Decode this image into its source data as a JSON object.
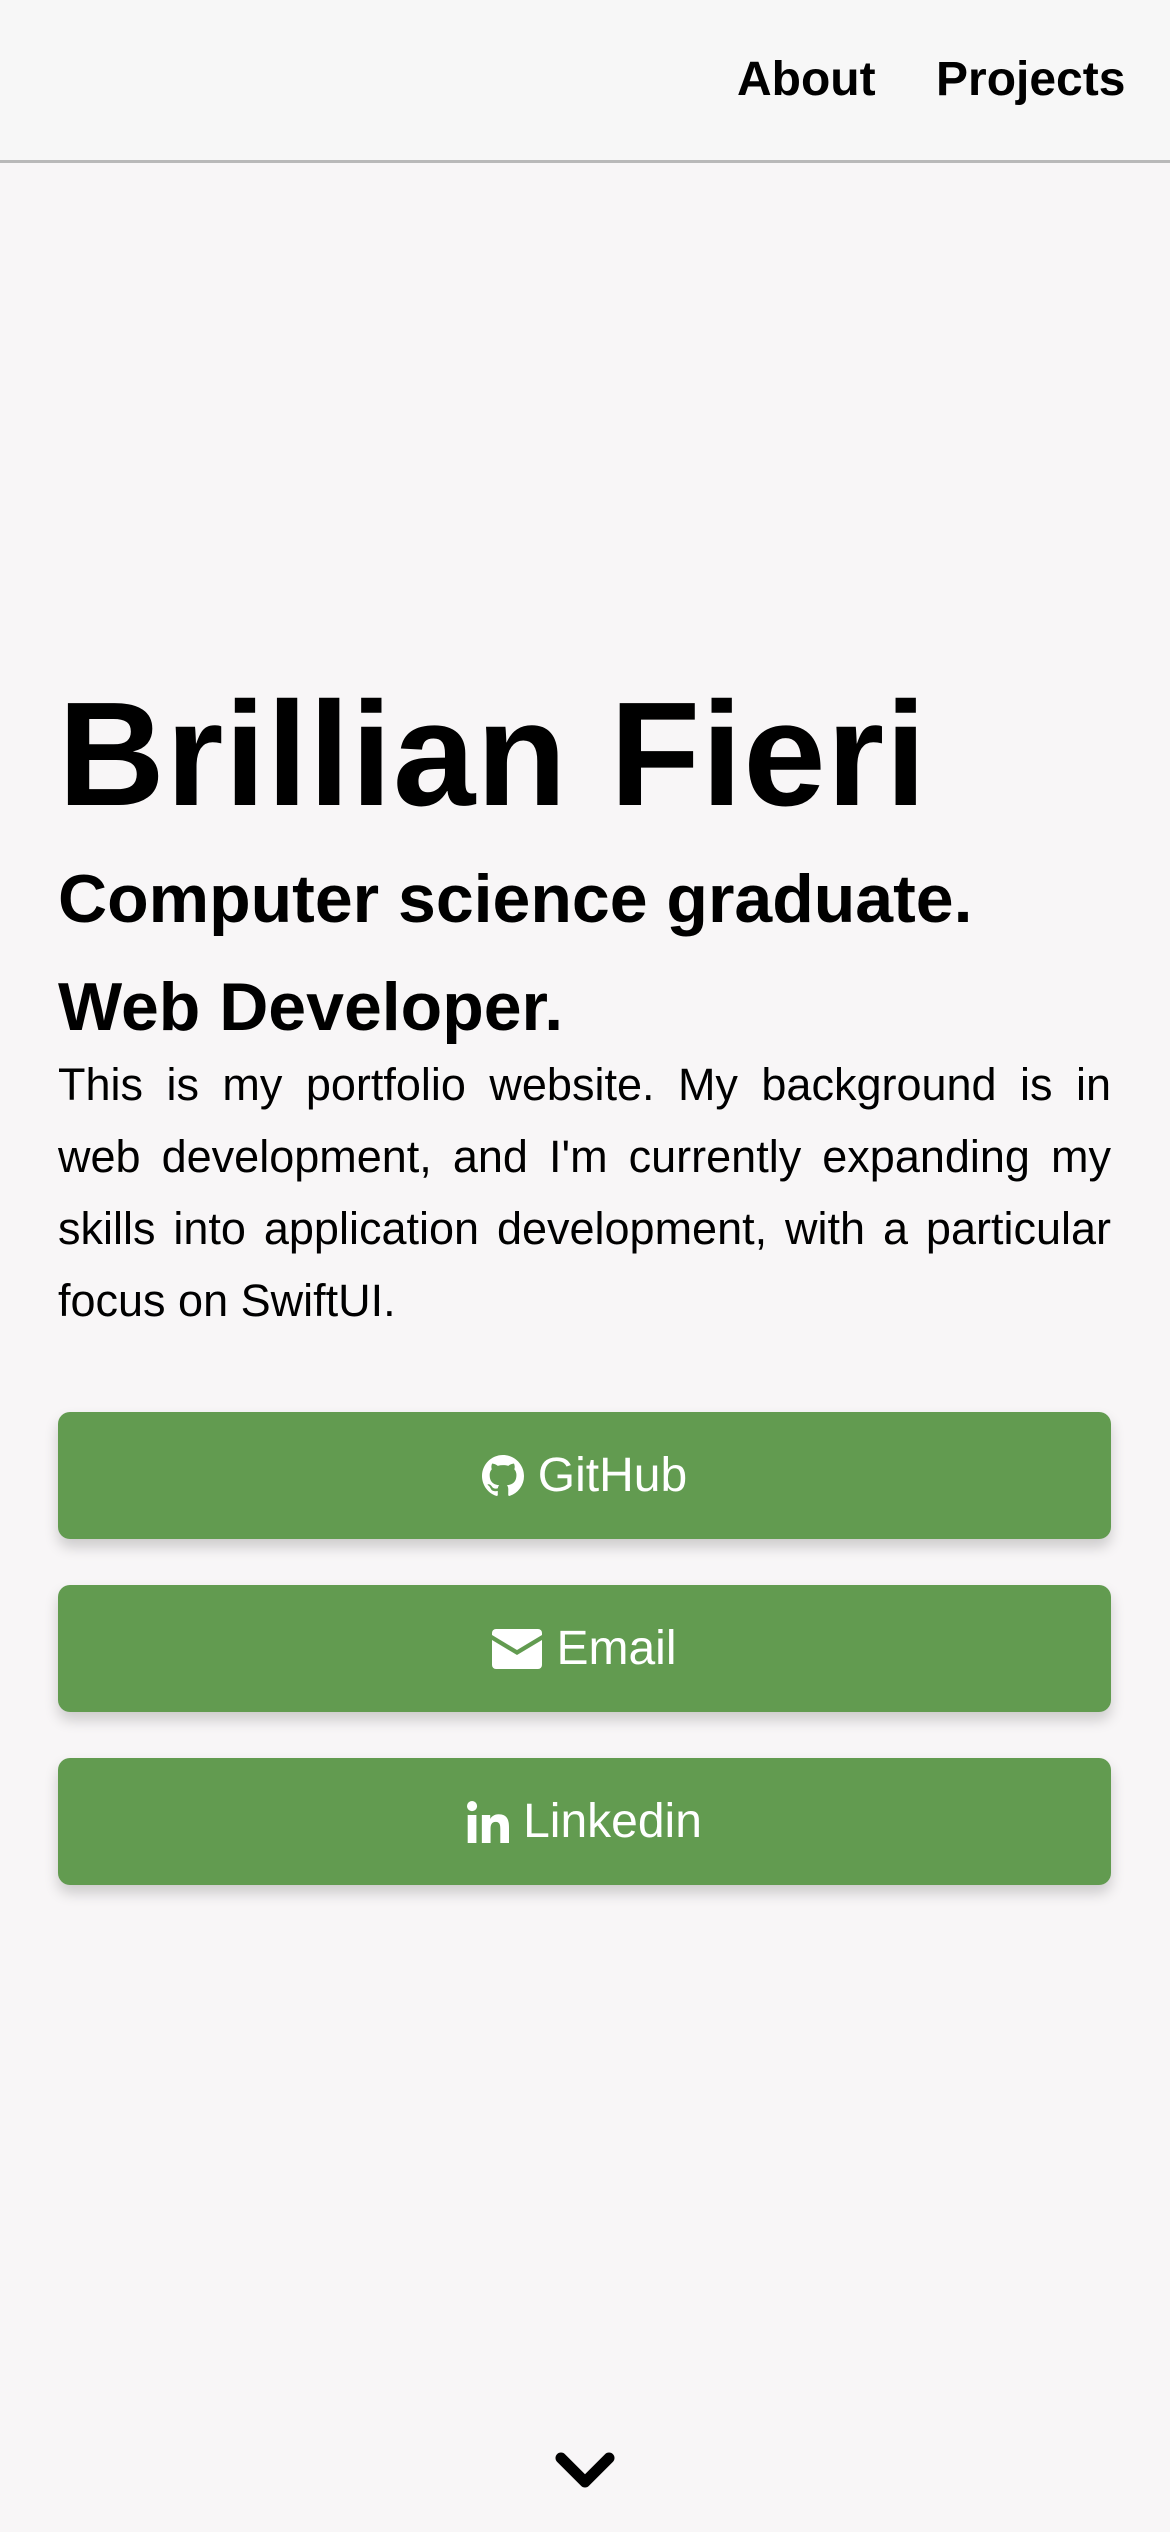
{
  "nav": {
    "items": [
      {
        "label": "About"
      },
      {
        "label": "Projects"
      }
    ]
  },
  "hero": {
    "name": "Brillian Fieri",
    "tagline_1": "Computer science graduate.",
    "tagline_2": "Web Developer.",
    "description": "This is my portfolio website. My background is in web development, and I'm currently expanding my skills into application development, with a particular focus on SwiftUI."
  },
  "buttons": [
    {
      "label": "GitHub",
      "icon": "github-icon"
    },
    {
      "label": "Email",
      "icon": "envelope-icon"
    },
    {
      "label": "Linkedin",
      "icon": "linkedin-icon"
    }
  ],
  "scroll": {
    "icon": "chevron-down-icon"
  },
  "colors": {
    "background": "#f8f6f7",
    "button": "#629b50",
    "button_text": "#ffffff",
    "navbar_border": "#b9b9b9"
  }
}
